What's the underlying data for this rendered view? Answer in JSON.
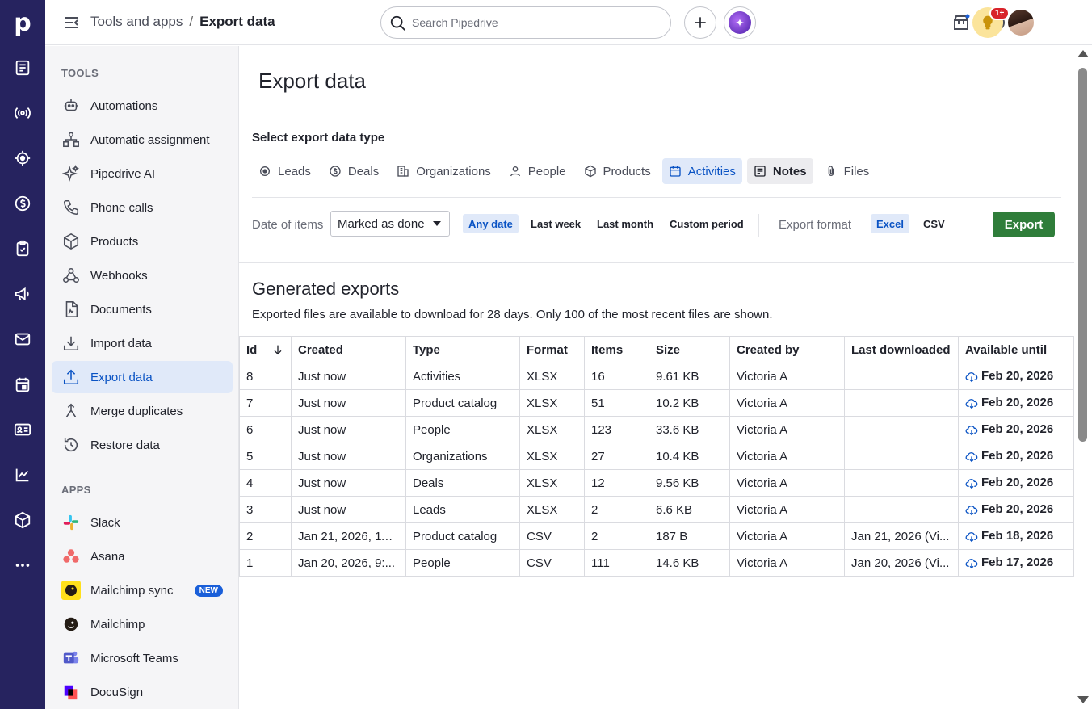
{
  "header": {
    "breadcrumb_parent": "Tools and apps",
    "breadcrumb_sep": "/",
    "breadcrumb_current": "Export data",
    "search_placeholder": "Search Pipedrive",
    "notification_badge": "1+"
  },
  "rail": {
    "logo": "p",
    "items": [
      "deals-list-icon",
      "broadcast-icon",
      "target-icon",
      "dollar-icon",
      "clipboard-icon",
      "megaphone-icon",
      "mail-icon",
      "calendar-icon",
      "contacts-card-icon",
      "chart-icon",
      "cube-icon",
      "more-icon"
    ]
  },
  "sidebar": {
    "tools_heading": "TOOLS",
    "tools": [
      {
        "label": "Automations",
        "icon": "robot-icon"
      },
      {
        "label": "Automatic assignment",
        "icon": "assignment-icon"
      },
      {
        "label": "Pipedrive AI",
        "icon": "sparkle-icon"
      },
      {
        "label": "Phone calls",
        "icon": "phone-icon"
      },
      {
        "label": "Products",
        "icon": "box-icon"
      },
      {
        "label": "Webhooks",
        "icon": "webhook-icon"
      },
      {
        "label": "Documents",
        "icon": "document-icon"
      },
      {
        "label": "Import data",
        "icon": "import-icon"
      },
      {
        "label": "Export data",
        "icon": "export-icon",
        "active": true
      },
      {
        "label": "Merge duplicates",
        "icon": "merge-icon"
      },
      {
        "label": "Restore data",
        "icon": "restore-icon"
      }
    ],
    "apps_heading": "APPS",
    "apps": [
      {
        "label": "Slack",
        "icon": "slack-icon"
      },
      {
        "label": "Asana",
        "icon": "asana-icon"
      },
      {
        "label": "Mailchimp sync",
        "icon": "mailchimp-sync-icon",
        "badge": "NEW"
      },
      {
        "label": "Mailchimp",
        "icon": "mailchimp-icon"
      },
      {
        "label": "Microsoft Teams",
        "icon": "teams-icon"
      },
      {
        "label": "DocuSign",
        "icon": "docusign-icon"
      }
    ]
  },
  "main": {
    "title": "Export data",
    "select_label": "Select export data type",
    "types": [
      {
        "label": "Leads",
        "icon": "target-icon"
      },
      {
        "label": "Deals",
        "icon": "dollar-icon"
      },
      {
        "label": "Organizations",
        "icon": "building-icon"
      },
      {
        "label": "People",
        "icon": "person-icon"
      },
      {
        "label": "Products",
        "icon": "box-icon"
      },
      {
        "label": "Activities",
        "icon": "calendar-icon",
        "state": "selected"
      },
      {
        "label": "Notes",
        "icon": "note-icon",
        "state": "hover"
      },
      {
        "label": "Files",
        "icon": "paperclip-icon"
      }
    ],
    "date_label": "Date of items",
    "date_select": "Marked as done",
    "date_options": [
      "Any date",
      "Last week",
      "Last month",
      "Custom period"
    ],
    "date_selected": "Any date",
    "format_label": "Export format",
    "format_options": [
      "Excel",
      "CSV"
    ],
    "format_selected": "Excel",
    "export_button": "Export",
    "generated_title": "Generated exports",
    "generated_subtitle": "Exported files are available to download for 28 days. Only 100 of the most recent files are shown."
  },
  "table": {
    "columns": [
      "Id",
      "Created",
      "Type",
      "Format",
      "Items",
      "Size",
      "Created by",
      "Last downloaded",
      "Available until"
    ],
    "rows": [
      [
        "8",
        "Just now",
        "Activities",
        "XLSX",
        "16",
        "9.61 KB",
        "Victoria A",
        "",
        "Feb 20, 2026"
      ],
      [
        "7",
        "Just now",
        "Product catalog",
        "XLSX",
        "51",
        "10.2 KB",
        "Victoria A",
        "",
        "Feb 20, 2026"
      ],
      [
        "6",
        "Just now",
        "People",
        "XLSX",
        "123",
        "33.6 KB",
        "Victoria A",
        "",
        "Feb 20, 2026"
      ],
      [
        "5",
        "Just now",
        "Organizations",
        "XLSX",
        "27",
        "10.4 KB",
        "Victoria A",
        "",
        "Feb 20, 2026"
      ],
      [
        "4",
        "Just now",
        "Deals",
        "XLSX",
        "12",
        "9.56 KB",
        "Victoria A",
        "",
        "Feb 20, 2026"
      ],
      [
        "3",
        "Just now",
        "Leads",
        "XLSX",
        "2",
        "6.6 KB",
        "Victoria A",
        "",
        "Feb 20, 2026"
      ],
      [
        "2",
        "Jan 21, 2026, 11:...",
        "Product catalog",
        "CSV",
        "2",
        "187 B",
        "Victoria A",
        "Jan 21, 2026 (Vi...",
        "Feb 18, 2026"
      ],
      [
        "1",
        "Jan 20, 2026, 9:...",
        "People",
        "CSV",
        "111",
        "14.6 KB",
        "Victoria A",
        "Jan 20, 2026 (Vi...",
        "Feb 17, 2026"
      ]
    ]
  },
  "colors": {
    "rail_bg": "#26235f",
    "accent_blue": "#0a53c4",
    "active_bg": "#e0e9f9",
    "export_green": "#2f7d3a"
  }
}
